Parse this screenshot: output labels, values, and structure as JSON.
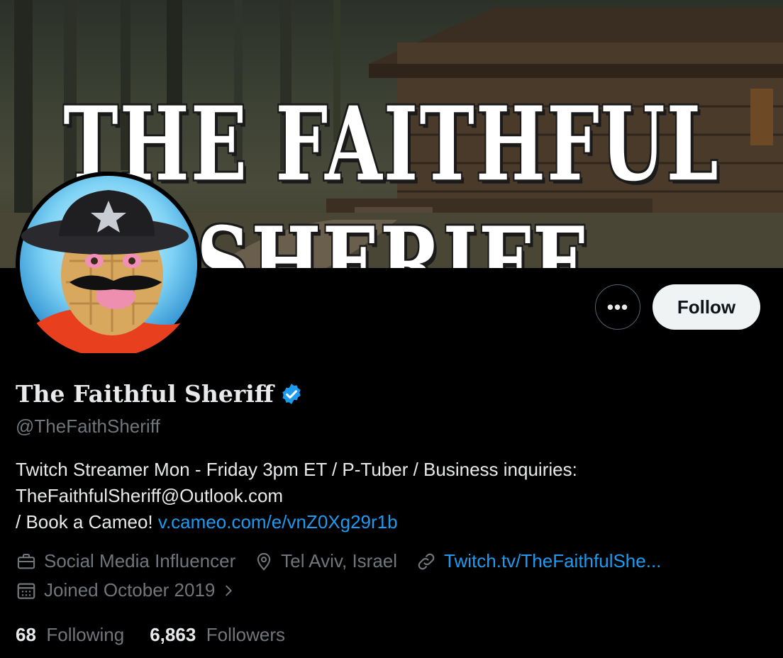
{
  "banner": {
    "title": "THE FAITHFUL SHERIFF"
  },
  "actions": {
    "more_label": "•••",
    "follow_label": "Follow"
  },
  "profile": {
    "display_name": "The Faithful Sheriff",
    "handle": "@TheFaithSheriff",
    "bio_line1": "Twitch Streamer Mon - Friday 3pm ET / P-Tuber /  Business inquiries:",
    "bio_line2": "TheFaithfulSheriff@Outlook.com",
    "bio_line3_prefix": "/ Book a Cameo! ",
    "bio_link": "v.cameo.com/e/vnZ0Xg29r1b",
    "category": "Social Media Influencer",
    "location": "Tel Aviv, Israel",
    "website": "Twitch.tv/TheFaithfulShe...",
    "joined": "Joined October 2019"
  },
  "stats": {
    "following_count": "68",
    "following_label": "Following",
    "followers_count": "6,863",
    "followers_label": "Followers"
  },
  "colors": {
    "background": "#000000",
    "text_primary": "#e7e9ea",
    "text_secondary": "#71767b",
    "link": "#1d9bf0",
    "verified": "#1d9bf0",
    "follow_bg": "#eff3f4"
  },
  "icons": {
    "verified": "verified-badge-icon",
    "category": "briefcase-icon",
    "location": "location-pin-icon",
    "website": "link-icon",
    "joined": "calendar-icon",
    "chevron": "chevron-right-icon"
  }
}
